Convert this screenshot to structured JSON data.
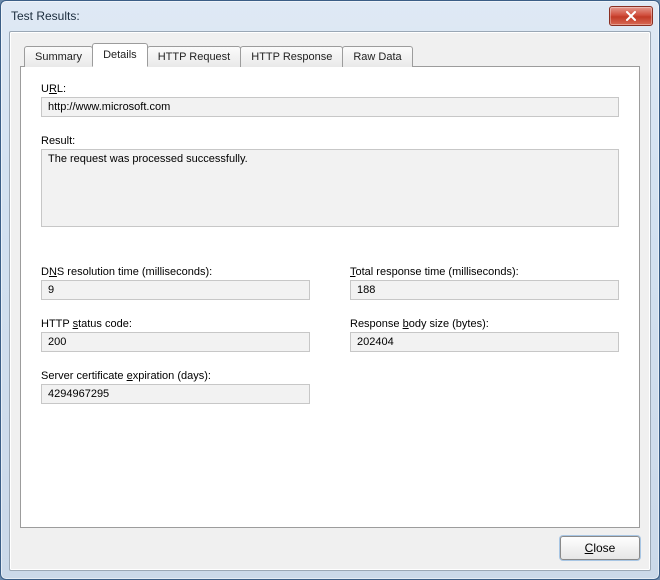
{
  "window": {
    "title": "Test Results:"
  },
  "tabs": {
    "summary": "Summary",
    "details": "Details",
    "http_request": "HTTP Request",
    "http_response": "HTTP Response",
    "raw_data": "Raw Data"
  },
  "details": {
    "url_label_pre": "U",
    "url_label_ul": "R",
    "url_label_post": "L:",
    "url_value": "http://www.microsoft.com",
    "result_label": "Result:",
    "result_value": "The request was processed successfully.",
    "dns_label_pre": "D",
    "dns_label_ul": "N",
    "dns_label_post": "S resolution time (milliseconds):",
    "dns_value": "9",
    "total_label_ul": "T",
    "total_label_post": "otal response time (milliseconds):",
    "total_value": "188",
    "status_label_pre": "HTTP ",
    "status_label_ul": "s",
    "status_label_post": "tatus code:",
    "status_value": "200",
    "body_label_pre": "Response ",
    "body_label_ul": "b",
    "body_label_post": "ody size (bytes):",
    "body_value": "202404",
    "cert_label_pre": "Server certificate ",
    "cert_label_ul": "e",
    "cert_label_post": "xpiration (days):",
    "cert_value": "4294967295"
  },
  "footer": {
    "close_ul": "C",
    "close_post": "lose"
  }
}
